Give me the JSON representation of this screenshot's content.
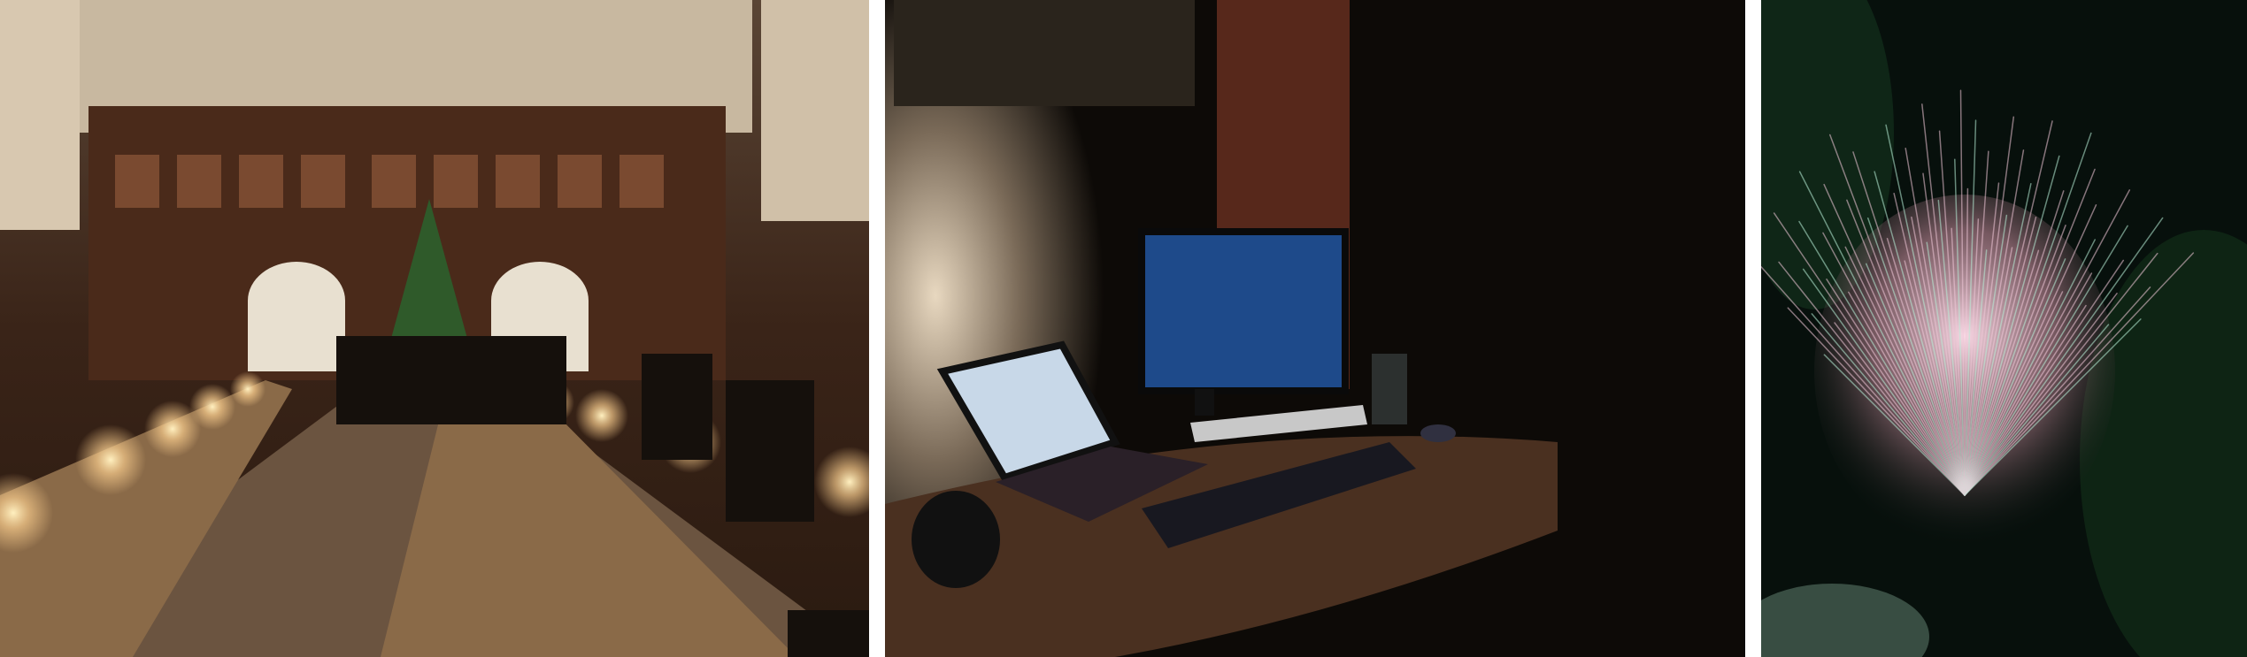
{
  "photos": [
    {
      "id": "dining-hall",
      "colors": {
        "wall": "#3a2418",
        "light": "#f5c98a",
        "floor": "#6b5440",
        "tree": "#2f5a2a"
      }
    },
    {
      "id": "desk-setup",
      "colors": {
        "wall": "#c9b8a0",
        "dark": "#0d0a07",
        "screen": "#1e4a8a",
        "desk": "#4a3020"
      }
    },
    {
      "id": "fireworks",
      "colors": {
        "sky": "#07100c",
        "spark": "#f0c8d8",
        "trail": "#b8f0d8",
        "foliage": "#12301c"
      }
    }
  ]
}
